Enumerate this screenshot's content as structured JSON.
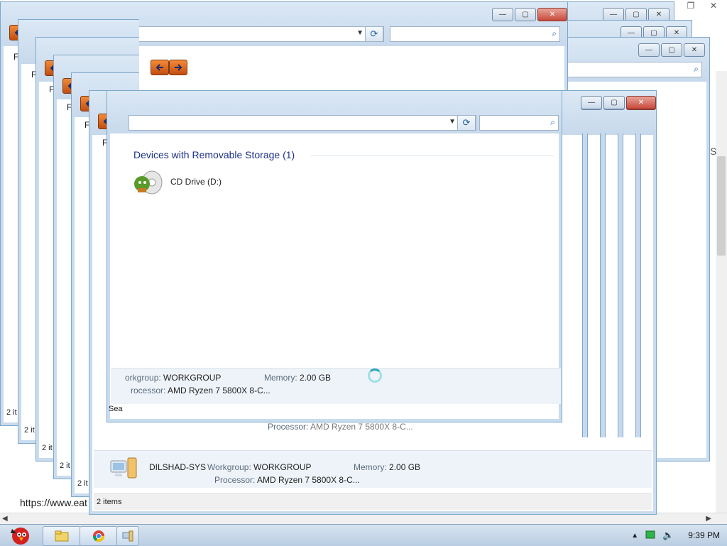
{
  "front_window": {
    "group_header": "Devices with Removable Storage (1)",
    "device_label": "CD Drive (D:)",
    "details": {
      "workgroup_label": "orkgroup:",
      "workgroup_value": "WORKGROUP",
      "memory_label": "Memory:",
      "memory_value": "2.00 GB",
      "processor_label": "rocessor:",
      "processor_value": "AMD Ryzen 7 5800X 8-C..."
    },
    "status_left": "Sea"
  },
  "bottom_window": {
    "computer_name": "DILSHAD-SYS",
    "workgroup_label": "Workgroup:",
    "workgroup_value": "WORKGROUP",
    "memory_label": "Memory:",
    "memory_value": "2.00 GB",
    "processor_label": "Processor:",
    "processor_value": "AMD Ryzen 7 5800X 8-C...",
    "status": "2 items"
  },
  "partial_window": {
    "processor_label": "Processor:",
    "processor_value": "AMD Ryzen 7 5800X 8-C..."
  },
  "stack_status_fragments": [
    "2 it",
    "2 it",
    "2 it",
    "2 it",
    "2 it"
  ],
  "menu_fragment": "F",
  "background_browser": {
    "status_url": "https://www.eat",
    "side_letter": "S"
  },
  "taskbar": {
    "clock": "9:39 PM",
    "pinned": [
      "angry-birds-start",
      "explorer-folder",
      "chrome",
      "system-props"
    ]
  },
  "colors": {
    "frame": "#c7d9ec",
    "close_button": "#c7483a",
    "nav_arrow": "#e06a1e",
    "group_header": "#1e3287"
  }
}
